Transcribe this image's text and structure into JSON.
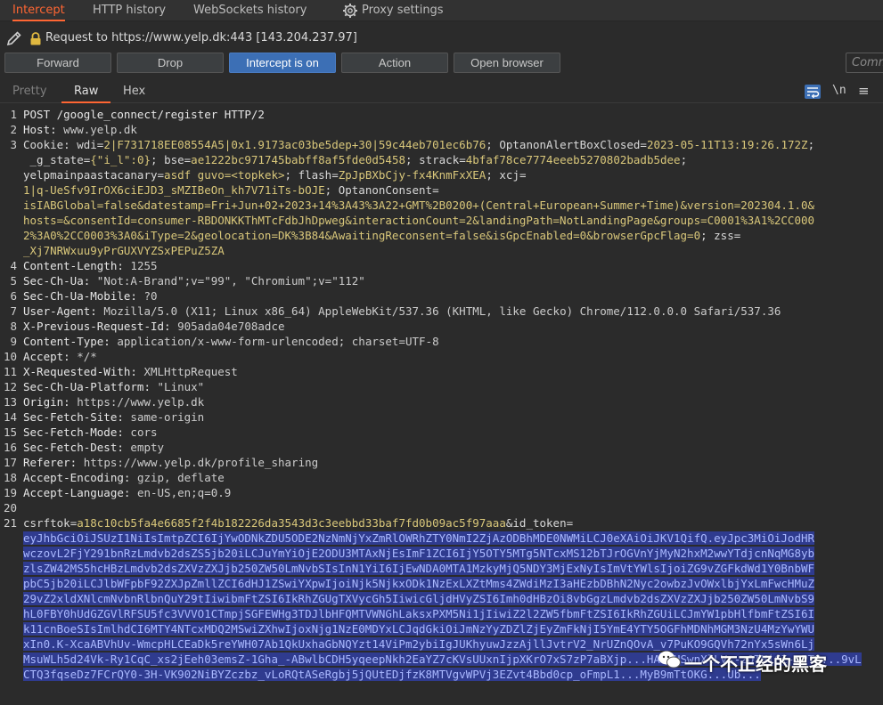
{
  "tabs": [
    "Intercept",
    "HTTP history",
    "WebSockets history",
    "Proxy settings"
  ],
  "request_line": "Request to https://www.yelp.dk:443  [143.204.237.97]",
  "buttons": {
    "forward": "Forward",
    "drop": "Drop",
    "intercept": "Intercept is on",
    "action": "Action",
    "open_browser": "Open browser"
  },
  "comment_placeholder": "Comm",
  "view_tabs": [
    "Pretty",
    "Raw",
    "Hex"
  ],
  "toolbar": {
    "newline_toggle": "\\n",
    "menu": "≡"
  },
  "accent_color": "#ff6633",
  "intercept_on_color": "#3c6fb5",
  "line_numbers": [
    "1",
    "2",
    "3",
    "4",
    "5",
    "6",
    "7",
    "8",
    "9",
    "10",
    "11",
    "12",
    "13",
    "14",
    "15",
    "16",
    "17",
    "18",
    "19",
    "20",
    "21"
  ],
  "request": {
    "request_line": "POST /google_connect/register HTTP/2",
    "host_key": "Host:",
    "host_val": " www.yelp.dk",
    "cookie_lines": [
      [
        [
          "Cookie: ",
          "k"
        ],
        [
          "wdi",
          "k"
        ],
        [
          "=",
          "k"
        ],
        [
          "2|F731718EE08554A5|0x1.9173ac03be5dep+30|59c44eb701ec6b76",
          "v"
        ],
        [
          "; ",
          "k"
        ],
        [
          "OptanonAlertBoxClosed",
          "k"
        ],
        [
          "=",
          "k"
        ],
        [
          "2023-05-11T13:19:26.172Z",
          "v"
        ],
        [
          ";",
          "k"
        ]
      ],
      [
        [
          " _g_state",
          "k"
        ],
        [
          "=",
          "k"
        ],
        [
          "{\"i_l\":0}",
          "v"
        ],
        [
          "; ",
          "k"
        ],
        [
          "bse",
          "k"
        ],
        [
          "=",
          "k"
        ],
        [
          "ae1222bc971745babff8af5fde0d5458",
          "v"
        ],
        [
          "; ",
          "k"
        ],
        [
          "strack",
          "k"
        ],
        [
          "=",
          "k"
        ],
        [
          "4bfaf78ce7774eeeb5270802badb5dee",
          "v"
        ],
        [
          ";",
          "k"
        ]
      ],
      [
        [
          "yelpmainpaastacanary",
          "k"
        ],
        [
          "=",
          "k"
        ],
        [
          "asdf",
          "v"
        ],
        [
          " guvo=<topkek>",
          "v"
        ],
        [
          "; ",
          "k"
        ],
        [
          "flash",
          "k"
        ],
        [
          "=",
          "k"
        ],
        [
          "ZpJpBXbCjy-fx4KnmFxXEA",
          "v"
        ],
        [
          "; ",
          "k"
        ],
        [
          "xcj",
          "k"
        ],
        [
          "=",
          "k"
        ]
      ],
      [
        [
          "1|q-UeSfv9IrOX6ciEJD3_sMZIBeOn_kh7V71iTs-bOJE",
          "v"
        ],
        [
          "; ",
          "k"
        ],
        [
          "OptanonConsent",
          "k"
        ],
        [
          "=",
          "k"
        ]
      ],
      [
        [
          "isIABGlobal=false&datestamp=Fri+Jun+02+2023+14%3A43%3A22+GMT%2B0200+(Central+European+Summer+Time)&version=202304.1.0&",
          "v"
        ]
      ],
      [
        [
          "hosts=&consentId=consumer-RBDONKKThMTcFdbJhDpweg&interactionCount=2&landingPath=NotLandingPage&groups=C0001%3A1%2CC000",
          "v"
        ]
      ],
      [
        [
          "2%3A0%2CC0003%3A0&iType=2&geolocation=DK%3B84&AwaitingReconsent=false&isGpcEnabled=0&browserGpcFlag=0",
          "v"
        ],
        [
          "; ",
          "k"
        ],
        [
          "zss",
          "k"
        ],
        [
          "=",
          "k"
        ]
      ],
      [
        [
          "_Xj7NRWxuu9yPrGUXVYZSxPEPuZ5ZA",
          "v"
        ]
      ]
    ],
    "headers": [
      [
        "Content-Length:",
        " 1255"
      ],
      [
        "Sec-Ch-Ua:",
        " \"Not:A-Brand\";v=\"99\", \"Chromium\";v=\"112\""
      ],
      [
        "Sec-Ch-Ua-Mobile:",
        " ?0"
      ],
      [
        "User-Agent:",
        " Mozilla/5.0 (X11; Linux x86_64) AppleWebKit/537.36 (KHTML, like Gecko) Chrome/112.0.0.0 Safari/537.36"
      ],
      [
        "X-Previous-Request-Id:",
        " 905ada04e708adce"
      ],
      [
        "Content-Type:",
        " application/x-www-form-urlencoded; charset=UTF-8"
      ],
      [
        "Accept:",
        " */*"
      ],
      [
        "X-Requested-With:",
        " XMLHttpRequest"
      ],
      [
        "Sec-Ch-Ua-Platform:",
        " \"Linux\""
      ],
      [
        "Origin:",
        " https://www.yelp.dk"
      ],
      [
        "Sec-Fetch-Site:",
        " same-origin"
      ],
      [
        "Sec-Fetch-Mode:",
        " cors"
      ],
      [
        "Sec-Fetch-Dest:",
        " empty"
      ],
      [
        "Referer:",
        " https://www.yelp.dk/profile_sharing"
      ],
      [
        "Accept-Encoding:",
        " gzip, deflate"
      ],
      [
        "Accept-Language:",
        " en-US,en;q=0.9"
      ]
    ],
    "body_lines": [
      [
        [
          "csrftok",
          "k"
        ],
        [
          "=",
          "k"
        ],
        [
          "a18c10cb5fa4e6685f2f4b182226da3543d3c3eebbd33baf7fd0b09ac5f97aaa",
          "v"
        ],
        [
          "&",
          "k"
        ],
        [
          "id_token",
          "k"
        ],
        [
          "=",
          "k"
        ]
      ]
    ],
    "token_lines": [
      "eyJhbGciOiJSUzI1NiIsImtpZCI6IjYwODNkZDU5ODE2NzNmNjYxZmRlOWRhZTY0NmI2ZjAzODBhMDE0NWMiLCJ0eXAiOiJKV1QifQ.eyJpc3MiOiJodHR",
      "wczovL2FjY291bnRzLmdvb2dsZS5jb20iLCJuYmYiOjE2ODU3MTAxNjEsImF1ZCI6IjY5OTY5MTg5NTcxMS12bTJrOGVnYjMyN2hxM2wwYTdjcnNqMG8yb",
      "zlsZW42MS5hcHBzLmdvb2dsZXVzZXJjb250ZW50LmNvbSIsInN1YiI6IjEwNDA0MTA1MzkyMjQ5NDY3MjExNyIsImVtYWlsIjoiZG9vZGFkdWd1Y0BnbWF",
      "pbC5jb20iLCJlbWFpbF92ZXJpZmllZCI6dHJ1ZSwiYXpwIjoiNjk5NjkxODk1NzExLXZtMms4ZWdiMzI3aHEzbDBhN2Nyc2owbzJvOWxlbjYxLmFwcHMuZ",
      "29vZ2xldXNlcmNvbnRlbnQuY29tIiwibmFtZSI6IkRhZGUgTXVycGh5IiwicGljdHVyZSI6Imh0dHBzOi8vbGgzLmdvb2dsZXVzZXJjb250ZW50LmNvbS9",
      "hL0FBY0hUdGZGVlRFSU5fc3VVVO1CTmpjSGFEWHg3TDJlbHFQMTVWNGhLaksxPXM5Ni1jIiwiZ2l2ZW5fbmFtZSI6IkRhZGUiLCJmYW1pbHlfbmFtZSI6I",
      "k11cnBoeSIsImlhdCI6MTY4NTcxMDQ2MSwiZXhwIjoxNjg1NzE0MDYxLCJqdGkiOiJmNzYyZDZlZjEyZmFkNjI5YmE4YTY5OGFhMDNhMGM3NzU4MzYwYWU",
      "xIn0.K-XcaABVhUv-WmcpHLCEaDk5reYWH07Ab1QkUxhaGbNQYzt14ViPm2ybiIgJUKhyuwJzzAjllJvtrV2_NrUZnQOvA_v7PuKO9GQVh72nYx5sWn6Lj",
      "MsuWLh5d24Vk-Ry1CqC_xs2jEeh03emsZ-1Gha_-ABwlbCDH5yqeepNkh2EaYZ7cKVsUUxnIjpXKrO7xS7zP7aBXjp...HA1gUSwnXlLVs-zOTHiCI-sPTS...9vL",
      "CTQ3fqseDz7FCrQY0-3H-VK902NiBYZczbz_vLoRQtASeRgbj5jQUtEDjfzK8MTVgvWPVj3EZvt4Bbd0cp_oFmpL1...MyB9mTtOKG...Ub..."
    ]
  },
  "watermark": "一个不正经的黑客"
}
